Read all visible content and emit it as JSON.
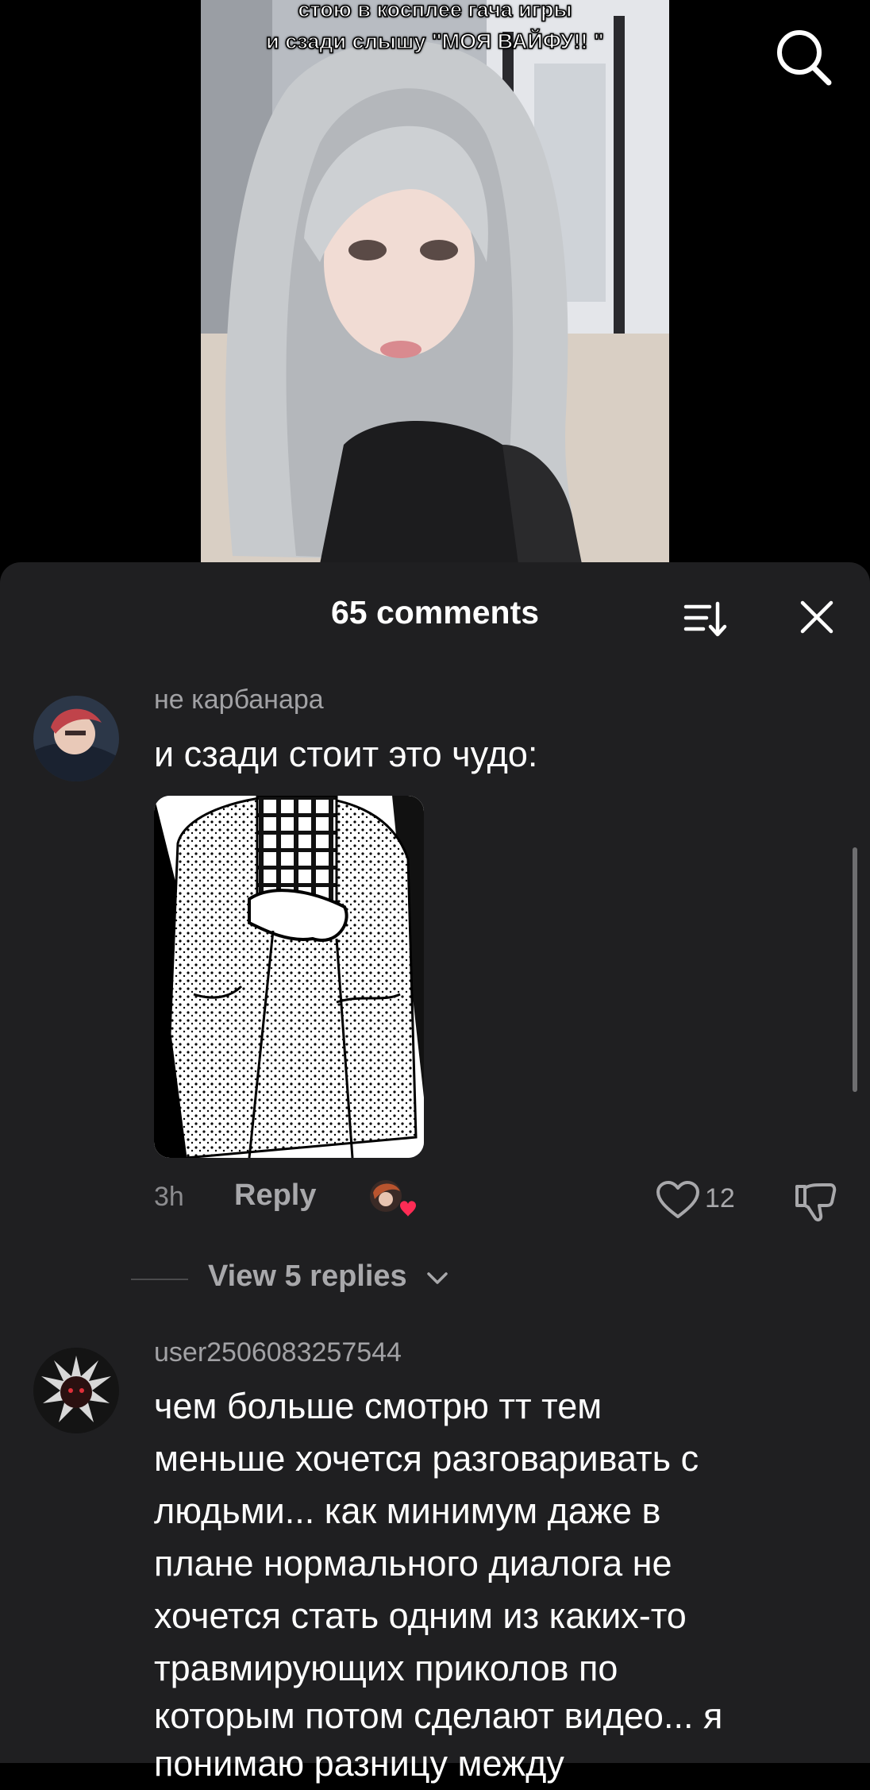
{
  "video": {
    "caption_line1": "стою в косплее гача игры",
    "caption_line2": "и сзади слышу \"МОЯ ВАЙФУ!! \""
  },
  "header": {
    "search_icon": "search-icon"
  },
  "comments_sheet": {
    "title": "65 comments",
    "sort_icon": "sort-icon",
    "close_icon": "close-icon"
  },
  "comments": [
    {
      "username": "не карбанара",
      "text": "и сзади стоит это чудо:",
      "time": "3h",
      "reply_label": "Reply",
      "like_count": "12",
      "view_replies_label": "View 5 replies"
    },
    {
      "username": "user2506083257544",
      "text_lines": [
        "чем больше смотрю тт тем",
        "меньше хочется разговаривать с",
        "людьми... как минимум даже в",
        "плане нормального диалога не",
        "хочется стать одним из каких-то",
        "травмирующих приколов по",
        "которым потом сделают видео... я",
        "понимаю разницу между"
      ]
    }
  ],
  "colors": {
    "sheet_bg": "#1f1f21",
    "muted_text": "#a2a2a5",
    "heart_red": "#fe2c55"
  }
}
